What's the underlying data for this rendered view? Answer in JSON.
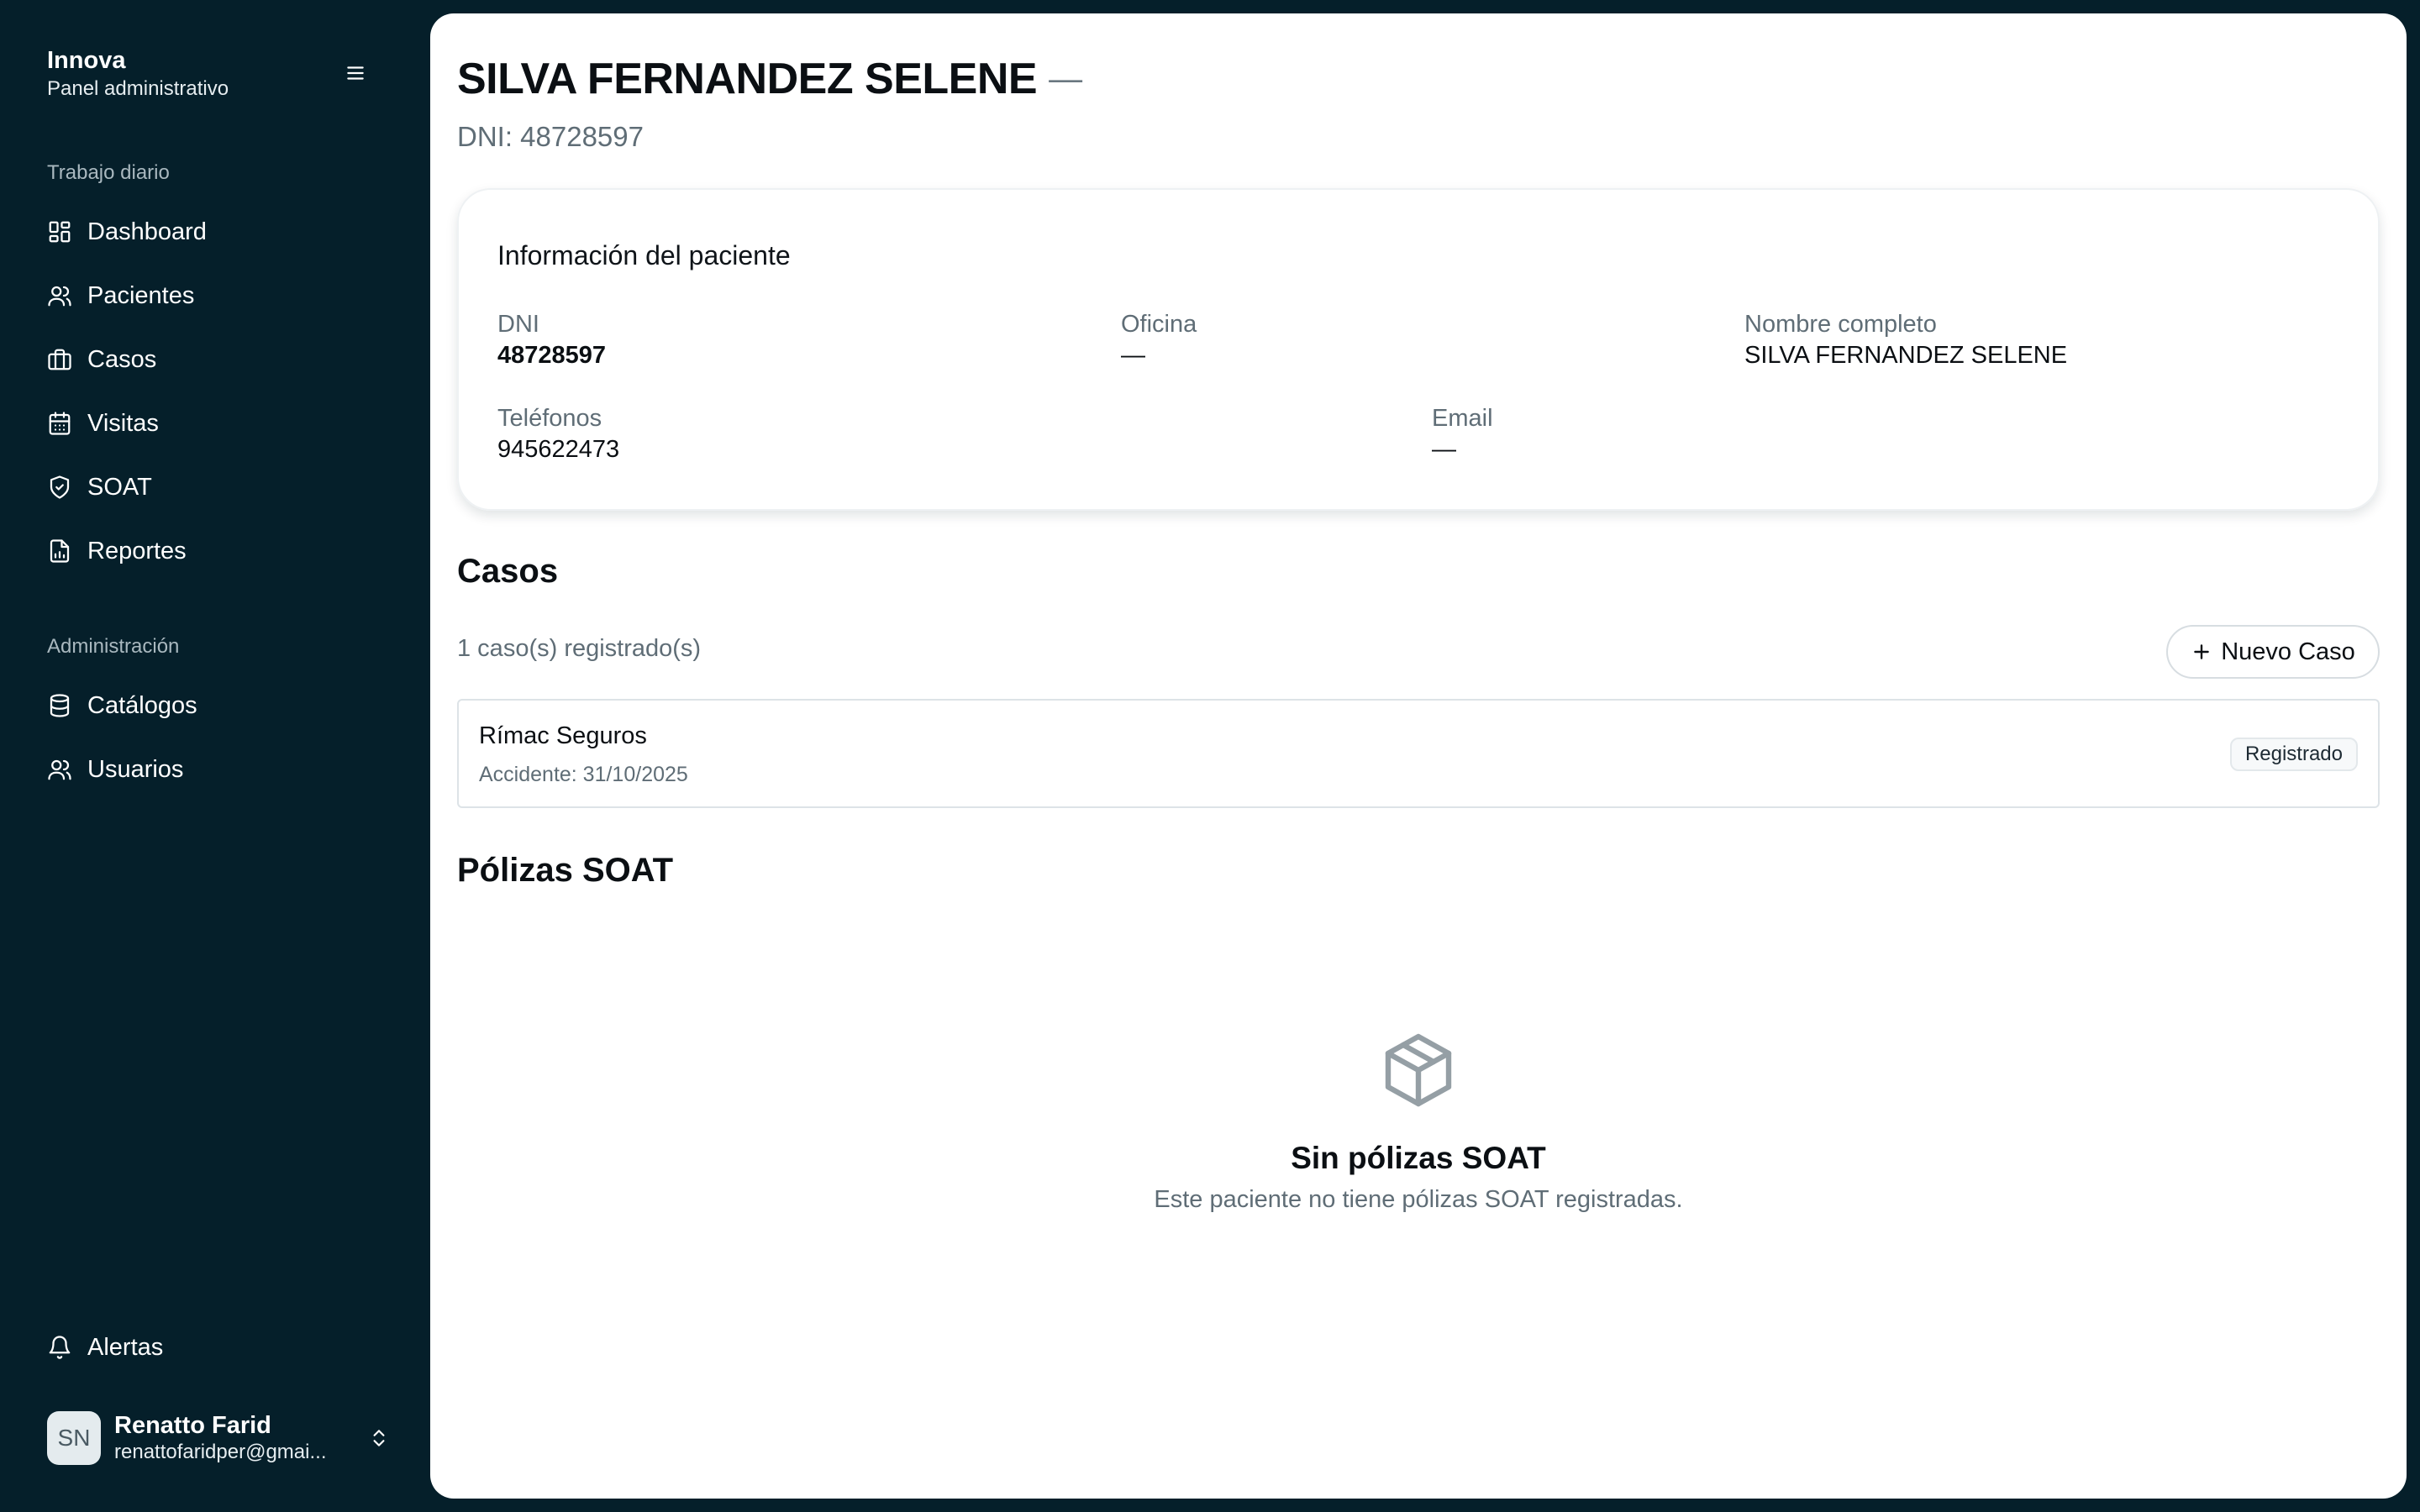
{
  "sidebar": {
    "brand_name": "Innova",
    "brand_subtitle": "Panel administrativo",
    "menu_icon": "hamburger-icon",
    "section_daily": "Trabajo diario",
    "section_admin": "Administración",
    "items": [
      {
        "label": "Dashboard",
        "icon": "dashboard-icon"
      },
      {
        "label": "Pacientes",
        "icon": "users-icon"
      },
      {
        "label": "Casos",
        "icon": "briefcase-icon"
      },
      {
        "label": "Visitas",
        "icon": "calendar-icon"
      },
      {
        "label": "SOAT",
        "icon": "shield-icon"
      },
      {
        "label": "Reportes",
        "icon": "report-icon"
      },
      {
        "label": "Catálogos",
        "icon": "database-icon"
      },
      {
        "label": "Usuarios",
        "icon": "users-icon"
      }
    ],
    "alerts_label": "Alertas",
    "user": {
      "initials": "SN",
      "name": "Renatto Farid",
      "email": "renattofaridper@gmai..."
    }
  },
  "patient": {
    "title": "SILVA FERNANDEZ SELENE",
    "title_suffix": "—",
    "subtitle": "DNI: 48728597"
  },
  "info_card": {
    "title": "Información del paciente",
    "fields": [
      {
        "label": "DNI",
        "value": "48728597"
      },
      {
        "label": "Oficina",
        "value": "—"
      },
      {
        "label": "Nombre completo",
        "value": "SILVA FERNANDEZ SELENE"
      },
      {
        "label": "Teléfonos",
        "value": "945622473"
      },
      {
        "label": "Email",
        "value": "—"
      }
    ]
  },
  "cases": {
    "title": "Casos",
    "count_text": "1 caso(s) registrado(s)",
    "new_button": "Nuevo Caso",
    "items": [
      {
        "insurer": "Rímac Seguros",
        "accident": "Accidente: 31/10/2025",
        "status": "Registrado"
      }
    ]
  },
  "soat": {
    "title": "Pólizas SOAT",
    "empty_icon": "package-icon",
    "empty_title": "Sin pólizas SOAT",
    "empty_text": "Este paciente no tiene pólizas SOAT registradas."
  }
}
